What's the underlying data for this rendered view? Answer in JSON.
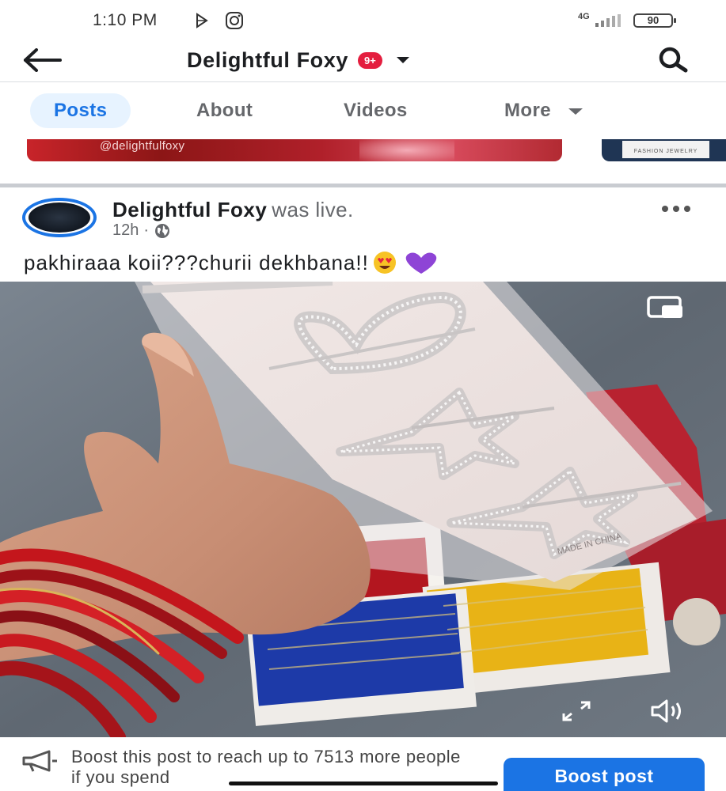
{
  "status_bar": {
    "time": "1:10 PM",
    "network": "4G",
    "battery": "90"
  },
  "header": {
    "title": "Delightful Foxy",
    "badge": "9+"
  },
  "tabs": [
    {
      "label": "Posts",
      "active": true
    },
    {
      "label": "About",
      "active": false
    },
    {
      "label": "Videos",
      "active": false
    },
    {
      "label": "More",
      "active": false
    }
  ],
  "featured": {
    "handle": "@delightfulfoxy",
    "tag_text": "FASHION JEWELRY"
  },
  "post": {
    "author": "Delightful Foxy",
    "action": "was live.",
    "time": "12h",
    "caption": "pakhiraaa koii???churii dekhbana!!",
    "emojis": [
      "heart-eyes-emoji",
      "purple-heart-emoji"
    ]
  },
  "video": {
    "card_print": "MADE IN CHINA"
  },
  "boost": {
    "text": "Boost this post to reach up to 7513 more people if you spend",
    "button_label": "Boost post"
  },
  "colors": {
    "accent": "#1b74e4",
    "badge": "#e41e3f",
    "tab_active_bg": "#e7f3ff"
  }
}
